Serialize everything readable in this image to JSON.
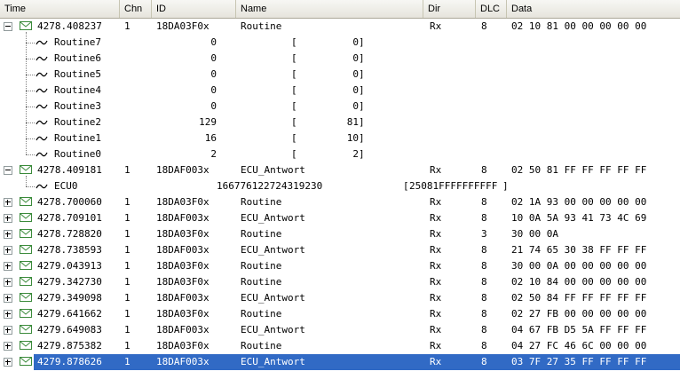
{
  "columns": {
    "time": "Time",
    "chn": "Chn",
    "id": "ID",
    "name": "Name",
    "dir": "Dir",
    "dlc": "DLC",
    "data": "Data"
  },
  "messages": [
    {
      "time": "4278.408237",
      "chn": "1",
      "id": "18DA03F0x",
      "name": "Routine",
      "dir": "Rx",
      "dlc": "8",
      "data": "02 10 81 00 00 00 00 00",
      "expanded": true,
      "signals": [
        {
          "name": "Routine7",
          "phys": "0",
          "raw": "0"
        },
        {
          "name": "Routine6",
          "phys": "0",
          "raw": "0"
        },
        {
          "name": "Routine5",
          "phys": "0",
          "raw": "0"
        },
        {
          "name": "Routine4",
          "phys": "0",
          "raw": "0"
        },
        {
          "name": "Routine3",
          "phys": "0",
          "raw": "0"
        },
        {
          "name": "Routine2",
          "phys": "129",
          "raw": "81"
        },
        {
          "name": "Routine1",
          "phys": "16",
          "raw": "10"
        },
        {
          "name": "Routine0",
          "phys": "2",
          "raw": "2"
        }
      ]
    },
    {
      "time": "4278.409181",
      "chn": "1",
      "id": "18DAF003x",
      "name": "ECU_Antwort",
      "dir": "Rx",
      "dlc": "8",
      "data": "02 50 81 FF FF FF FF FF",
      "expanded": true,
      "signals": [
        {
          "name": "ECU0",
          "phys": "166776122724319230",
          "raw": "25081FFFFFFFFFF"
        }
      ]
    },
    {
      "time": "4278.700060",
      "chn": "1",
      "id": "18DA03F0x",
      "name": "Routine",
      "dir": "Rx",
      "dlc": "8",
      "data": "02 1A 93 00 00 00 00 00",
      "expanded": false
    },
    {
      "time": "4278.709101",
      "chn": "1",
      "id": "18DAF003x",
      "name": "ECU_Antwort",
      "dir": "Rx",
      "dlc": "8",
      "data": "10 0A 5A 93 41 73 4C 69",
      "expanded": false
    },
    {
      "time": "4278.728820",
      "chn": "1",
      "id": "18DA03F0x",
      "name": "Routine",
      "dir": "Rx",
      "dlc": "3",
      "data": "30 00 0A",
      "expanded": false
    },
    {
      "time": "4278.738593",
      "chn": "1",
      "id": "18DAF003x",
      "name": "ECU_Antwort",
      "dir": "Rx",
      "dlc": "8",
      "data": "21 74 65 30 38 FF FF FF",
      "expanded": false
    },
    {
      "time": "4279.043913",
      "chn": "1",
      "id": "18DA03F0x",
      "name": "Routine",
      "dir": "Rx",
      "dlc": "8",
      "data": "30 00 0A 00 00 00 00 00",
      "expanded": false
    },
    {
      "time": "4279.342730",
      "chn": "1",
      "id": "18DA03F0x",
      "name": "Routine",
      "dir": "Rx",
      "dlc": "8",
      "data": "02 10 84 00 00 00 00 00",
      "expanded": false
    },
    {
      "time": "4279.349098",
      "chn": "1",
      "id": "18DAF003x",
      "name": "ECU_Antwort",
      "dir": "Rx",
      "dlc": "8",
      "data": "02 50 84 FF FF FF FF FF",
      "expanded": false
    },
    {
      "time": "4279.641662",
      "chn": "1",
      "id": "18DA03F0x",
      "name": "Routine",
      "dir": "Rx",
      "dlc": "8",
      "data": "02 27 FB 00 00 00 00 00",
      "expanded": false
    },
    {
      "time": "4279.649083",
      "chn": "1",
      "id": "18DAF003x",
      "name": "ECU_Antwort",
      "dir": "Rx",
      "dlc": "8",
      "data": "04 67 FB D5 5A FF FF FF",
      "expanded": false
    },
    {
      "time": "4279.875382",
      "chn": "1",
      "id": "18DA03F0x",
      "name": "Routine",
      "dir": "Rx",
      "dlc": "8",
      "data": "04 27 FC 46 6C 00 00 00",
      "expanded": false
    },
    {
      "time": "4279.878626",
      "chn": "1",
      "id": "18DAF003x",
      "name": "ECU_Antwort",
      "dir": "Rx",
      "dlc": "8",
      "data": "03 7F 27 35 FF FF FF FF",
      "expanded": false,
      "selected": true
    }
  ],
  "colors": {
    "selection": "#316ac5",
    "envelope": "#3a8a3a",
    "header": "#ece9d8"
  }
}
